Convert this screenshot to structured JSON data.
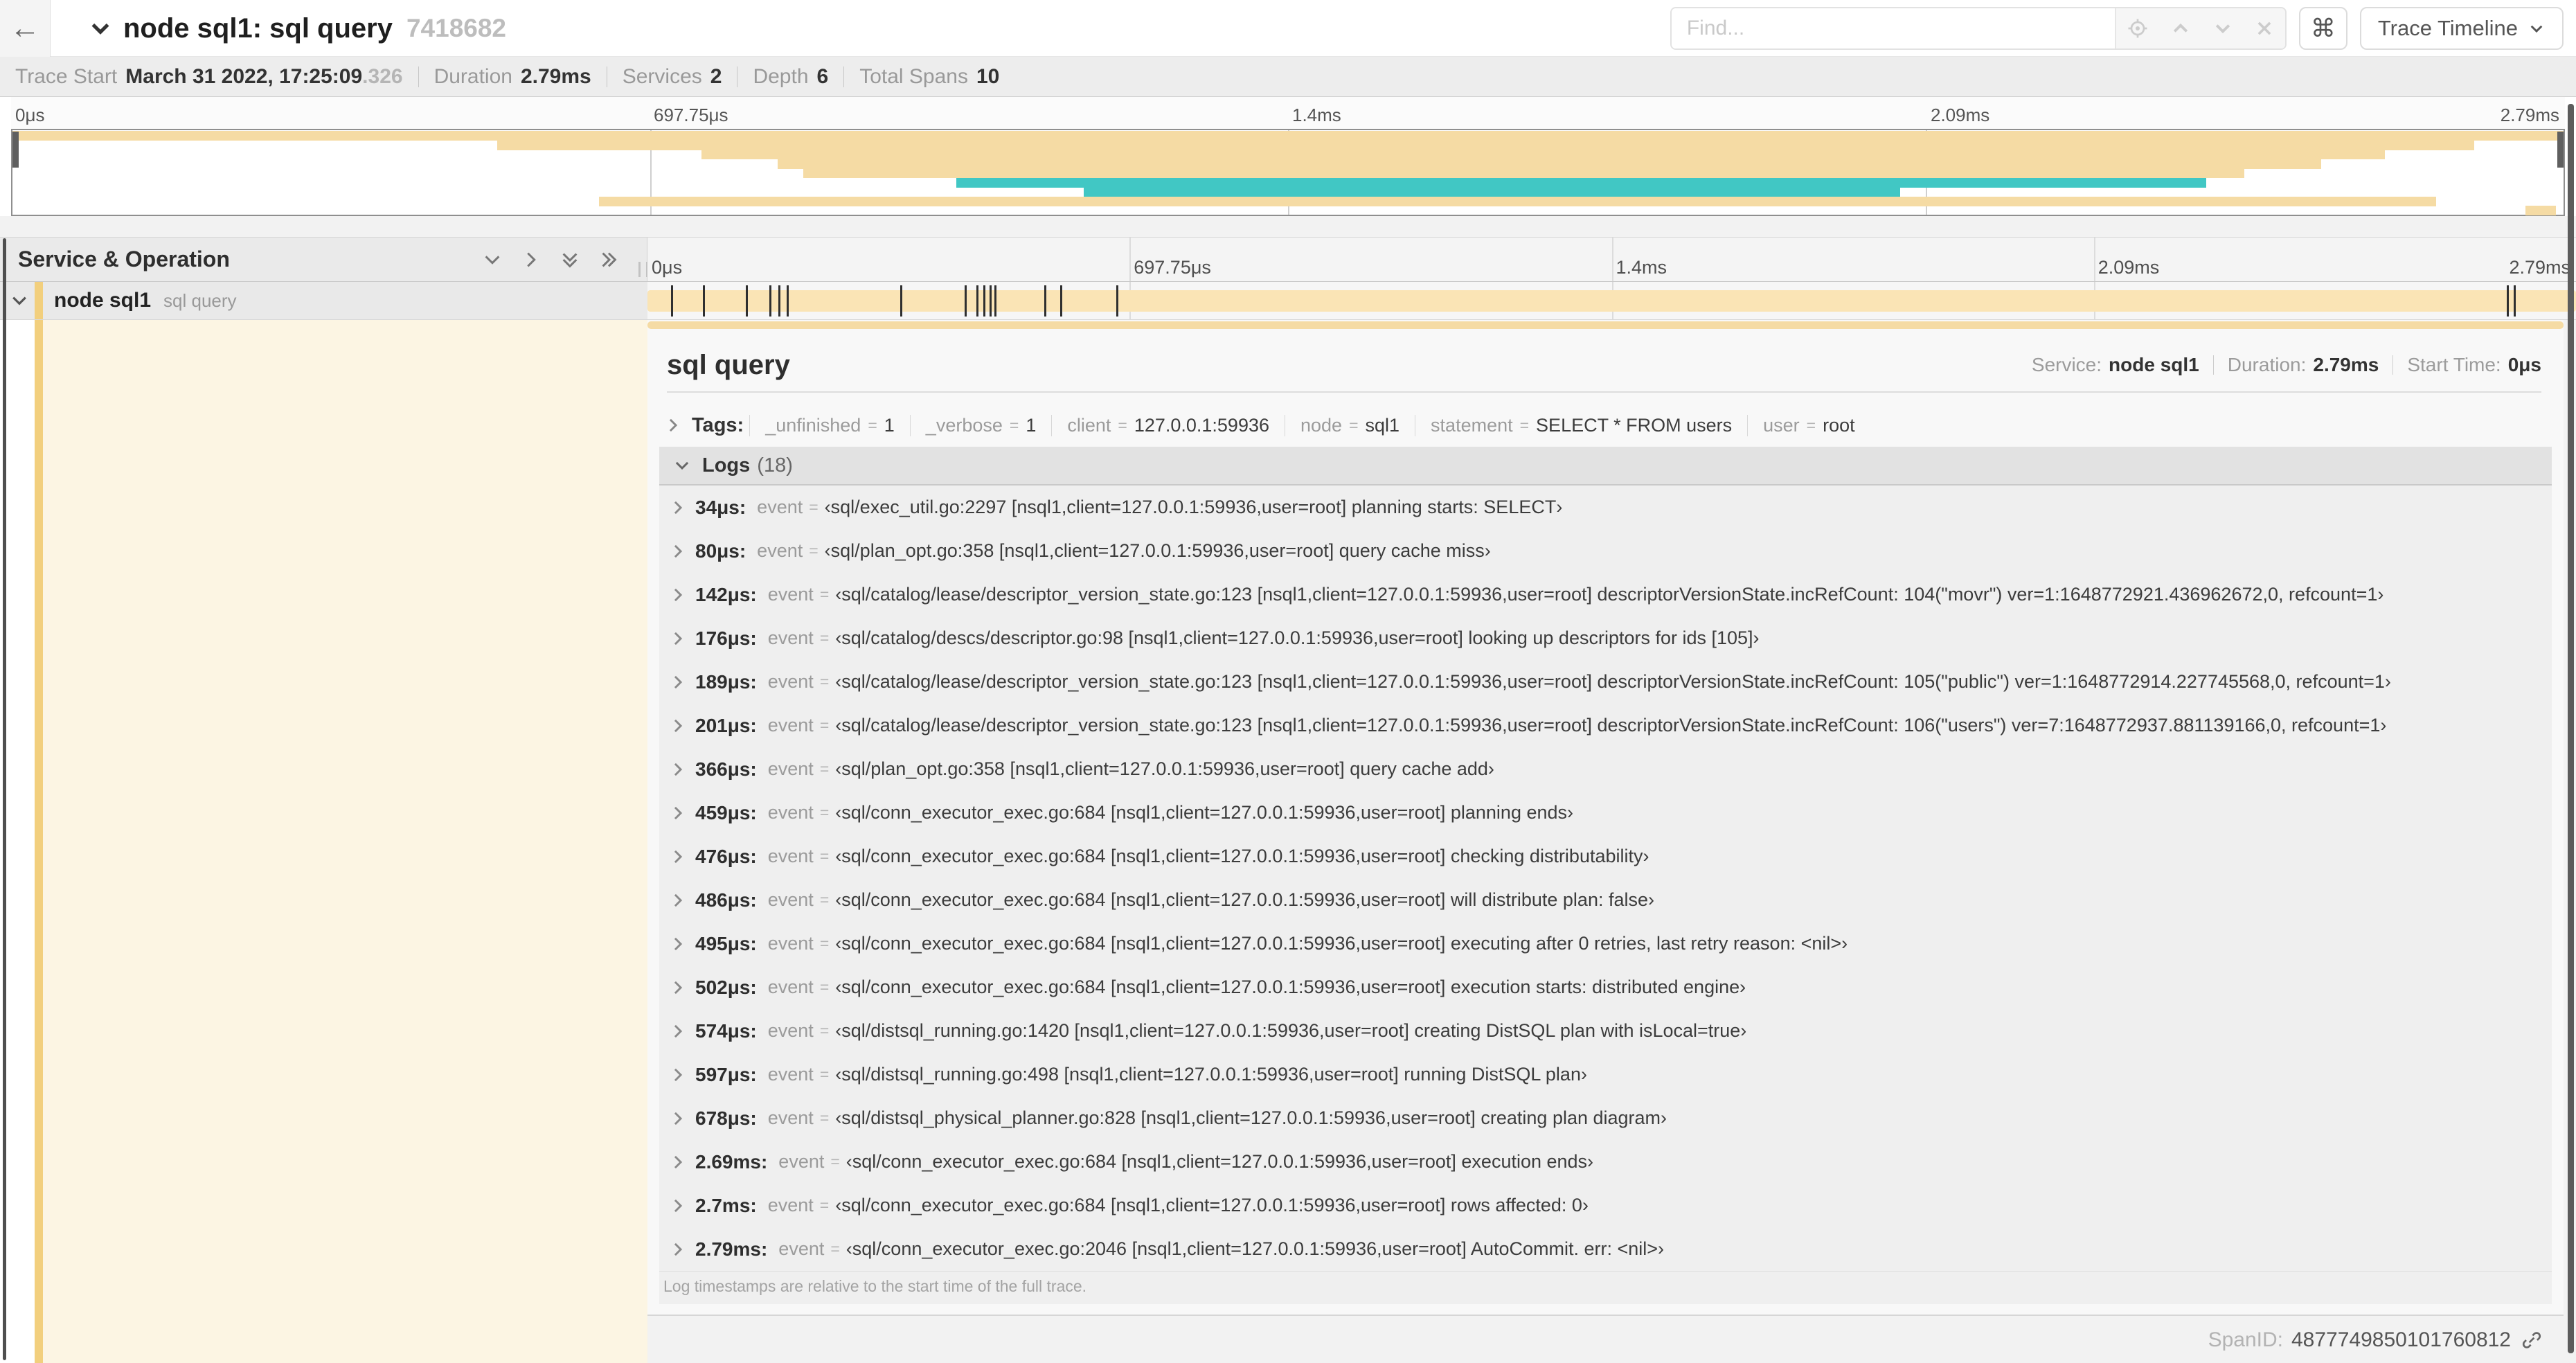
{
  "header": {
    "title": "node sql1: sql query",
    "trace_id": "7418682",
    "find_placeholder": "Find...",
    "view_button": "Trace Timeline",
    "icons": [
      "back-arrow-icon",
      "chevron-down-icon",
      "locate-icon",
      "chevron-up-icon",
      "chevron-down-icon",
      "close-icon",
      "command-key-icon"
    ],
    "command_key_glyph": "⌘",
    "back_glyph": "←"
  },
  "infobar": {
    "items": [
      {
        "label": "Trace Start",
        "value": "March 31 2022, 17:25:09",
        "suffix": ".326"
      },
      {
        "label": "Duration",
        "value": "2.79ms"
      },
      {
        "label": "Services",
        "value": "2"
      },
      {
        "label": "Depth",
        "value": "6"
      },
      {
        "label": "Total Spans",
        "value": "10"
      }
    ]
  },
  "timeline": {
    "ticks": [
      "0μs",
      "697.75μs",
      "1.4ms",
      "2.09ms",
      "2.79ms"
    ],
    "trace_duration_us": 2790,
    "colors": {
      "span_yellow": "#f5dba4",
      "span_bar_light": "#fae4b5",
      "span_teal": "#41c7c4",
      "accent_stripe": "#f2cf7d",
      "cream": "#fcf5e3"
    },
    "minimap_bars": [
      {
        "row": 0,
        "l": 0,
        "w": 100,
        "c": "yellow"
      },
      {
        "row": 1,
        "l": 19,
        "w": 77.5,
        "c": "yellow"
      },
      {
        "row": 2,
        "l": 27,
        "w": 66,
        "c": "yellow"
      },
      {
        "row": 3,
        "l": 30,
        "w": 60.5,
        "c": "yellow"
      },
      {
        "row": 4,
        "l": 31,
        "w": 56.5,
        "c": "yellow"
      },
      {
        "row": 5,
        "l": 37,
        "w": 49,
        "c": "teal"
      },
      {
        "row": 6,
        "l": 42,
        "w": 32,
        "c": "teal"
      },
      {
        "row": 7,
        "l": 23,
        "w": 72,
        "c": "yellow"
      },
      {
        "row": 8,
        "l": 98.5,
        "w": 1.2,
        "c": "yellow"
      }
    ]
  },
  "tree": {
    "header": "Service & Operation",
    "row": {
      "service": "node sql1",
      "operation": "sql query"
    }
  },
  "detail": {
    "title": "sql query",
    "meta": [
      {
        "label": "Service:",
        "value": "node sql1"
      },
      {
        "label": "Duration:",
        "value": "2.79ms"
      },
      {
        "label": "Start Time:",
        "value": "0μs"
      }
    ],
    "tags_label": "Tags:",
    "tags": [
      {
        "key": "_unfinished",
        "value": "1"
      },
      {
        "key": "_verbose",
        "value": "1"
      },
      {
        "key": "client",
        "value": "127.0.0.1:59936"
      },
      {
        "key": "node",
        "value": "sql1"
      },
      {
        "key": "statement",
        "value": "SELECT * FROM users"
      },
      {
        "key": "user",
        "value": "root"
      }
    ],
    "logs_label": "Logs",
    "logs_count": "(18)",
    "log_key": "event",
    "logs": [
      {
        "time": "34μs:",
        "us": 34,
        "value": "‹sql/exec_util.go:2297 [nsql1,client=127.0.0.1:59936,user=root] planning starts: SELECT›"
      },
      {
        "time": "80μs:",
        "us": 80,
        "value": "‹sql/plan_opt.go:358 [nsql1,client=127.0.0.1:59936,user=root] query cache miss›"
      },
      {
        "time": "142μs:",
        "us": 142,
        "value": "‹sql/catalog/lease/descriptor_version_state.go:123 [nsql1,client=127.0.0.1:59936,user=root] descriptorVersionState.incRefCount: 104(\"movr\") ver=1:1648772921.436962672,0, refcount=1›"
      },
      {
        "time": "176μs:",
        "us": 176,
        "value": "‹sql/catalog/descs/descriptor.go:98 [nsql1,client=127.0.0.1:59936,user=root] looking up descriptors for ids [105]›"
      },
      {
        "time": "189μs:",
        "us": 189,
        "value": "‹sql/catalog/lease/descriptor_version_state.go:123 [nsql1,client=127.0.0.1:59936,user=root] descriptorVersionState.incRefCount: 105(\"public\") ver=1:1648772914.227745568,0, refcount=1›"
      },
      {
        "time": "201μs:",
        "us": 201,
        "value": "‹sql/catalog/lease/descriptor_version_state.go:123 [nsql1,client=127.0.0.1:59936,user=root] descriptorVersionState.incRefCount: 106(\"users\") ver=7:1648772937.881139166,0, refcount=1›"
      },
      {
        "time": "366μs:",
        "us": 366,
        "value": "‹sql/plan_opt.go:358 [nsql1,client=127.0.0.1:59936,user=root] query cache add›"
      },
      {
        "time": "459μs:",
        "us": 459,
        "value": "‹sql/conn_executor_exec.go:684 [nsql1,client=127.0.0.1:59936,user=root] planning ends›"
      },
      {
        "time": "476μs:",
        "us": 476,
        "value": "‹sql/conn_executor_exec.go:684 [nsql1,client=127.0.0.1:59936,user=root] checking distributability›"
      },
      {
        "time": "486μs:",
        "us": 486,
        "value": "‹sql/conn_executor_exec.go:684 [nsql1,client=127.0.0.1:59936,user=root] will distribute plan: false›"
      },
      {
        "time": "495μs:",
        "us": 495,
        "value": "‹sql/conn_executor_exec.go:684 [nsql1,client=127.0.0.1:59936,user=root] executing after 0 retries, last retry reason: <nil>›"
      },
      {
        "time": "502μs:",
        "us": 502,
        "value": "‹sql/conn_executor_exec.go:684 [nsql1,client=127.0.0.1:59936,user=root] execution starts: distributed engine›"
      },
      {
        "time": "574μs:",
        "us": 574,
        "value": "‹sql/distsql_running.go:1420 [nsql1,client=127.0.0.1:59936,user=root] creating DistSQL plan with isLocal=true›"
      },
      {
        "time": "597μs:",
        "us": 597,
        "value": "‹sql/distsql_running.go:498 [nsql1,client=127.0.0.1:59936,user=root] running DistSQL plan›"
      },
      {
        "time": "678μs:",
        "us": 678,
        "value": "‹sql/distsql_physical_planner.go:828 [nsql1,client=127.0.0.1:59936,user=root] creating plan diagram›"
      },
      {
        "time": "2.69ms:",
        "us": 2690,
        "value": "‹sql/conn_executor_exec.go:684 [nsql1,client=127.0.0.1:59936,user=root] execution ends›"
      },
      {
        "time": "2.7ms:",
        "us": 2700,
        "value": "‹sql/conn_executor_exec.go:684 [nsql1,client=127.0.0.1:59936,user=root] rows affected: 0›"
      },
      {
        "time": "2.79ms:",
        "us": 2790,
        "value": "‹sql/conn_executor_exec.go:2046 [nsql1,client=127.0.0.1:59936,user=root] AutoCommit. err: <nil>›"
      }
    ],
    "logs_note": "Log timestamps are relative to the start time of the full trace.",
    "footer_label": "SpanID:",
    "footer_value": "4877749850101760812"
  }
}
